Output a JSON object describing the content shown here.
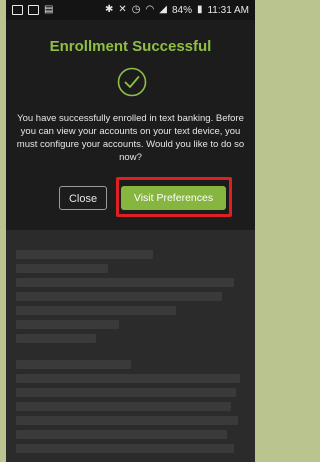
{
  "status_bar": {
    "battery": "84%",
    "time": "11:31 AM"
  },
  "dialog": {
    "title": "Enrollment Successful",
    "message": "You have successfully enrolled in text banking. Before you can view your accounts on your text device, you must configure your accounts. Would you like to do so now?",
    "close_label": "Close",
    "visit_label": "Visit Preferences"
  },
  "colors": {
    "accent_green": "#86b540",
    "title_green": "#8fbf45",
    "highlight_red": "#e02020"
  }
}
